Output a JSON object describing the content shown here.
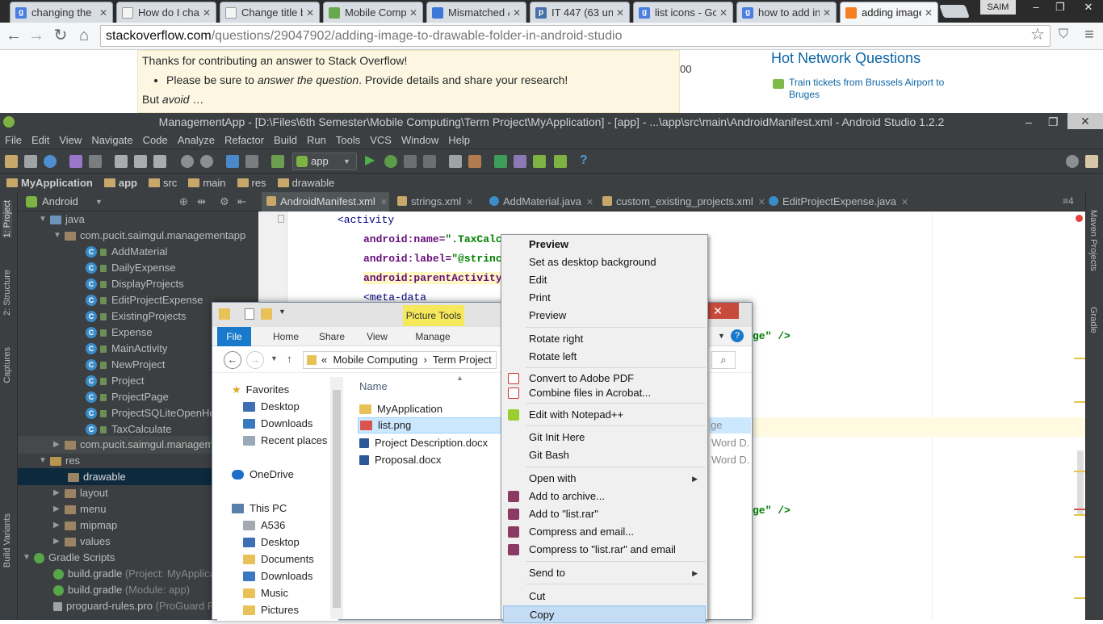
{
  "chrome": {
    "tabs": [
      {
        "label": "changing the",
        "icon": "google-icon",
        "color": "#4a7fe0"
      },
      {
        "label": "How do I char",
        "icon": "document-icon",
        "color": "#f4f4f4"
      },
      {
        "label": "Change title b",
        "icon": "document-icon",
        "color": "#f4f4f4"
      },
      {
        "label": "Mobile Comp",
        "icon": "image-icon",
        "color": "#6aa84f"
      },
      {
        "label": "Mismatched &",
        "icon": "page-icon",
        "color": "#3b78d8"
      },
      {
        "label": "IT 447 (63 unr",
        "icon": "portal-icon",
        "color": "#4a6fa8"
      },
      {
        "label": "list icons - Go",
        "icon": "google-icon",
        "color": "#4a7fe0"
      },
      {
        "label": "how to add in",
        "icon": "google-icon",
        "color": "#4a7fe0"
      },
      {
        "label": "adding image",
        "icon": "stackoverflow-icon",
        "color": "#f48024"
      }
    ],
    "user": "SAIM",
    "url_domain": "stackoverflow.com",
    "url_path": "/questions/29047902/adding-image-to-drawable-folder-in-android-studio"
  },
  "so": {
    "notice_title": "Thanks for contributing an answer to Stack Overflow!",
    "bullet_pre": "Please be sure to ",
    "bullet_em": "answer the question",
    "bullet_post": ". Provide details and share your research!",
    "but_pre": "But ",
    "but_em": "avoid",
    "but_post": " …",
    "counter_fragment": "00",
    "hnq_title": "Hot Network Questions",
    "hnq_link": "Train tickets from Brussels Airport to Bruges"
  },
  "studio": {
    "title": "ManagementApp - [D:\\Files\\6th Semester\\Mobile Computing\\Term Project\\MyApplication] - [app] - ...\\app\\src\\main\\AndroidManifest.xml - Android Studio 1.2.2",
    "menu": [
      "File",
      "Edit",
      "View",
      "Navigate",
      "Code",
      "Analyze",
      "Refactor",
      "Build",
      "Run",
      "Tools",
      "VCS",
      "Window",
      "Help"
    ],
    "run_config": "app",
    "breadcrumbs": [
      "MyApplication",
      "app",
      "src",
      "main",
      "res",
      "drawable"
    ],
    "project_view": "Android",
    "left_tabs": [
      "1: Project",
      "2: Structure",
      "Captures",
      "Build Variants"
    ],
    "right_tabs": [
      "Maven Projects",
      "Gradle"
    ],
    "tree": {
      "java": "java",
      "package": "com.pucit.saimgul.managementapp",
      "classes": [
        "AddMaterial",
        "DailyExpense",
        "DisplayProjects",
        "EditProjectExpense",
        "ExistingProjects",
        "Expense",
        "MainActivity",
        "NewProject",
        "Project",
        "ProjectPage",
        "ProjectSQLiteOpenHelp",
        "TaxCalculate"
      ],
      "package2": "com.pucit.saimgul.managem",
      "res": "res",
      "res_children": [
        "drawable",
        "layout",
        "menu",
        "mipmap",
        "values"
      ],
      "gradle_scripts": "Gradle Scripts",
      "gradle_files": [
        {
          "name": "build.gradle",
          "note": "(Project: MyApplicati"
        },
        {
          "name": "build.gradle",
          "note": "(Module: app)"
        },
        {
          "name": "proguard-rules.pro",
          "note": "(ProGuard Rul"
        }
      ]
    },
    "editor_tabs": [
      "AndroidManifest.xml",
      "strings.xml",
      "AddMaterial.java",
      "custom_existing_projects.xml",
      "EditProjectExpense.java"
    ],
    "code": {
      "l1": "<activity",
      "l2_attr": "android:name=",
      "l2_val": "\".TaxCalc",
      "l3_attr": "android:label=",
      "l3_val": "\"@strinc",
      "l4_attr": "android:parentActivity",
      "l5": "<meta-data",
      "frag1": "ge\" />",
      "frag2": "ge\" />"
    }
  },
  "explorer": {
    "picture_tools": "Picture Tools",
    "ribbon_tabs": [
      "File",
      "Home",
      "Share",
      "View",
      "Manage"
    ],
    "address": [
      "«",
      "Mobile Computing",
      "›",
      "Term Project"
    ],
    "nav": {
      "favorites": "Favorites",
      "fav_items": [
        "Desktop",
        "Downloads",
        "Recent places"
      ],
      "onedrive": "OneDrive",
      "thispc": "This PC",
      "pc_items": [
        "A536",
        "Desktop",
        "Documents",
        "Downloads",
        "Music",
        "Pictures"
      ]
    },
    "column_name": "Name",
    "files": [
      {
        "name": "MyApplication",
        "type": ""
      },
      {
        "name": "list.png",
        "type": "ge"
      },
      {
        "name": "Project Description.docx",
        "type": "Word D."
      },
      {
        "name": "Proposal.docx",
        "type": "Word D."
      }
    ]
  },
  "context_menu": {
    "items": [
      {
        "label": "Preview",
        "bold": true
      },
      {
        "label": "Set as desktop background"
      },
      {
        "label": "Edit"
      },
      {
        "label": "Print"
      },
      {
        "label": "Preview"
      },
      {
        "label": "Rotate right"
      },
      {
        "label": "Rotate left"
      },
      {
        "label": "Convert to Adobe PDF"
      },
      {
        "label": "Combine files in Acrobat..."
      },
      {
        "label": "Edit with Notepad++"
      },
      {
        "label": "Git Init Here"
      },
      {
        "label": "Git Bash"
      },
      {
        "label": "Open with"
      },
      {
        "label": "Add to archive..."
      },
      {
        "label": "Add to \"list.rar\""
      },
      {
        "label": "Compress and email..."
      },
      {
        "label": "Compress to \"list.rar\" and email"
      },
      {
        "label": "Send to"
      },
      {
        "label": "Cut"
      },
      {
        "label": "Copy"
      }
    ]
  }
}
